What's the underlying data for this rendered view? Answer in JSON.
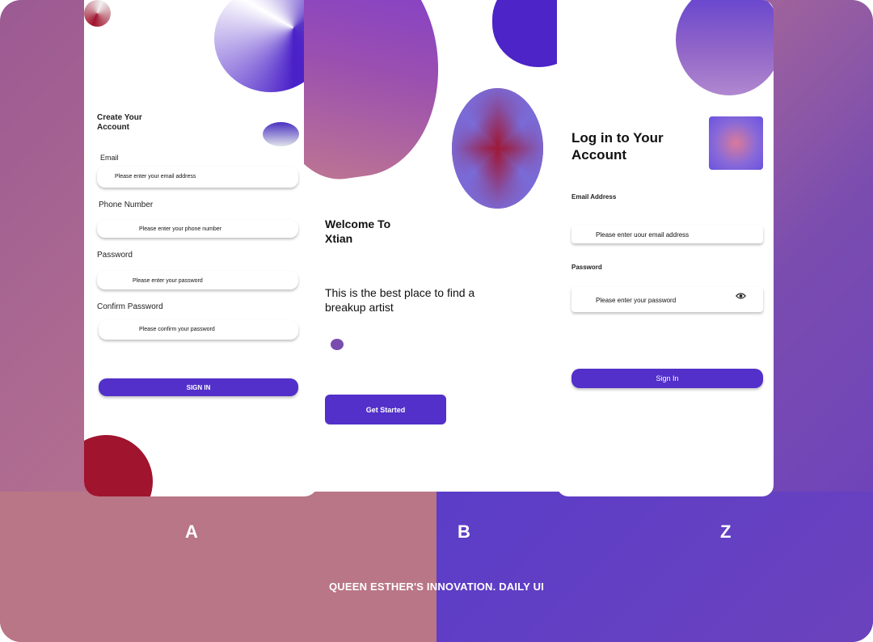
{
  "screen_a": {
    "title": "Create Your\nAccount",
    "email_label": "Email",
    "email_placeholder": "Please enter your email address",
    "phone_label": "Phone Number",
    "phone_placeholder": "Please enter your phone number",
    "password_label": "Password",
    "password_placeholder": "Please enter your password",
    "confirm_label": "Confirm Password",
    "confirm_placeholder": "Please confirm your password",
    "button_label": "SIGN IN"
  },
  "screen_b": {
    "title": "Welcome To\nXtian",
    "subtitle": "This is the best place to find a\nbreakup  artist",
    "button_label": "Get Started"
  },
  "screen_c": {
    "title": "Log in to Your\nAccount",
    "email_label": "Email Address",
    "email_placeholder": "Please enter uour email address",
    "password_label": "Password",
    "password_placeholder": "Please enter your password",
    "button_label": "Sign In",
    "eye_icon": "eye-icon"
  },
  "captions": {
    "a": "A",
    "b": "B",
    "c": "Z"
  },
  "footer": "QUEEN ESTHER'S INNOVATION.  DAILY UI",
  "colors": {
    "accent": "#5230c9",
    "crimson": "#a0142e",
    "bg_left": "#b97686",
    "bg_right": "#5b3dc8"
  }
}
